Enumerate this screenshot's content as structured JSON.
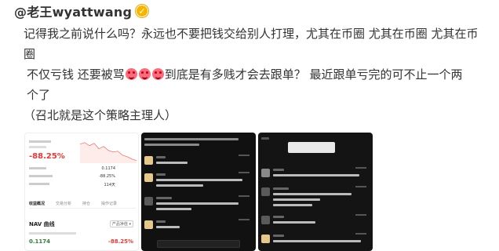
{
  "post": {
    "username": "@老王wyattwang",
    "verified_icon": "verified-badge-icon",
    "line1": "记得我之前说什么吗？永远也不要把钱交给别人打理，尤其在币圈 尤其在币圈 尤其在币",
    "line2": "圈",
    "line3a": "不仅亏钱 还要被骂",
    "emoji_icon": "heart-eyes-emoji-icon",
    "line3b": "到底是有多贱才会去跟单？ 最近跟单亏完的可不止一个两",
    "line4": "个了",
    "line5": "（召北就是这个策略主理人）"
  },
  "fund_card": {
    "return_pct": "-88.25%",
    "row1_value": "0.1174",
    "row2_value": "-88.25%",
    "row3_value": "114天",
    "tab_active": "收益概况",
    "tab2": "交易分析",
    "tab3": "持仓",
    "tab4": "操作记录",
    "nav_title": "NAV 曲线",
    "nav_button": "产品净值 ▾",
    "nav_value": "0.1174",
    "nav_change": "-88.25%"
  },
  "colors": {
    "text": "#333333",
    "red": "#e53935",
    "green": "#2e7d32",
    "verified": "#f7b500",
    "chat_bg": "#111111"
  }
}
